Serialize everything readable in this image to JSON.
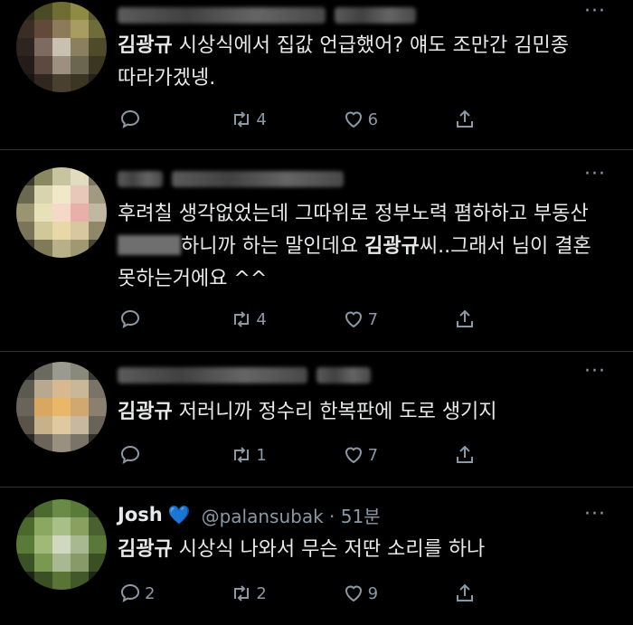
{
  "tweets": [
    {
      "text_parts": [
        {
          "t": "김광규",
          "b": true
        },
        {
          "t": " 시상식에서 집값 언급했어? 얘도 조만간 김민종 따라가겠넹.",
          "b": false
        }
      ],
      "replies": "",
      "retweets": "4",
      "likes": "6",
      "avatar_colors": [
        "#2b2a18",
        "#4a4a25",
        "#6f6d32",
        "#8f8a44",
        "#5a5a2e",
        "#3a2e22",
        "#62493a",
        "#8b7b5a",
        "#a89c60",
        "#6e6c3a",
        "#2f2520",
        "#7d6a60",
        "#c8c0b0",
        "#8a8060",
        "#4e4a2a",
        "#241c18",
        "#5c4a40",
        "#9e9080",
        "#6a6650",
        "#3a3620",
        "#181410",
        "#302820",
        "#4a4030",
        "#3a3622",
        "#24201a"
      ]
    },
    {
      "text_parts": [
        {
          "t": "후려칠 생각없었는데 그따위로 정부노력 폄하하고 부동산 ",
          "b": false
        },
        {
          "t": "",
          "censor": true
        },
        {
          "t": "하니까 하는 말인데요 ",
          "b": false
        },
        {
          "t": "김광규",
          "b": true
        },
        {
          "t": "씨..그래서 님이 결혼 못하는거에요 ^^",
          "b": false
        }
      ],
      "replies": "",
      "retweets": "4",
      "likes": "7",
      "avatar_colors": [
        "#3a3a2a",
        "#8a8860",
        "#c8c4a0",
        "#e0dcc0",
        "#7a7660",
        "#6a6850",
        "#d8d4b0",
        "#f0e8c8",
        "#e8c8b8",
        "#a09a80",
        "#9a9470",
        "#e8e0b8",
        "#f4d8c8",
        "#e8b0a8",
        "#c0b8a0",
        "#7a7458",
        "#d0c898",
        "#e8d8a8",
        "#d8c8a0",
        "#908868",
        "#3a382a",
        "#807a58",
        "#b8b088",
        "#a09870",
        "#4a4636"
      ]
    },
    {
      "text_parts": [
        {
          "t": "김광규",
          "b": true
        },
        {
          "t": " 저러니까 정수리 한복판에 도로 생기지",
          "b": false
        }
      ],
      "replies": "",
      "retweets": "1",
      "likes": "7",
      "avatar_colors": [
        "#2a2a26",
        "#6a6a60",
        "#9a9a90",
        "#8a8a7a",
        "#3a3a34",
        "#5a5a50",
        "#b8a890",
        "#d8b890",
        "#c8b898",
        "#7a7468",
        "#6a6458",
        "#d8a860",
        "#e8b868",
        "#d0a870",
        "#8a8070",
        "#5a5448",
        "#c8b088",
        "#e0c8a0",
        "#c8b8a0",
        "#6a6458",
        "#2a2824",
        "#6a645a",
        "#9a9080",
        "#7a7468",
        "#302e2a"
      ]
    },
    {
      "name": "Josh",
      "heart": "💙",
      "handle": "@palansubak · 51분",
      "text_parts": [
        {
          "t": "김광규",
          "b": true
        },
        {
          "t": " 시상식 나와서 무슨 저딴 소리를 하나",
          "b": false
        }
      ],
      "replies": "2",
      "retweets": "2",
      "likes": "9",
      "avatar_colors": [
        "#243018",
        "#4a6a30",
        "#6a8a48",
        "#5a7a3a",
        "#2a3a1c",
        "#4a6a2c",
        "#8aa860",
        "#a8c088",
        "#8aa060",
        "#4a6030",
        "#5a7a3a",
        "#a0b878",
        "#d0d8c0",
        "#a8b890",
        "#5a7838",
        "#3a5226",
        "#7a9850",
        "#a8b890",
        "#889a68",
        "#3a5024",
        "#1c2414",
        "#3a5024",
        "#5a7438",
        "#40582a",
        "#1e2816"
      ]
    }
  ],
  "icons": {
    "more": "more-horizontal-icon",
    "reply": "reply-bubble-icon",
    "retweet": "retweet-icon",
    "like": "heart-icon",
    "share": "share-icon"
  }
}
